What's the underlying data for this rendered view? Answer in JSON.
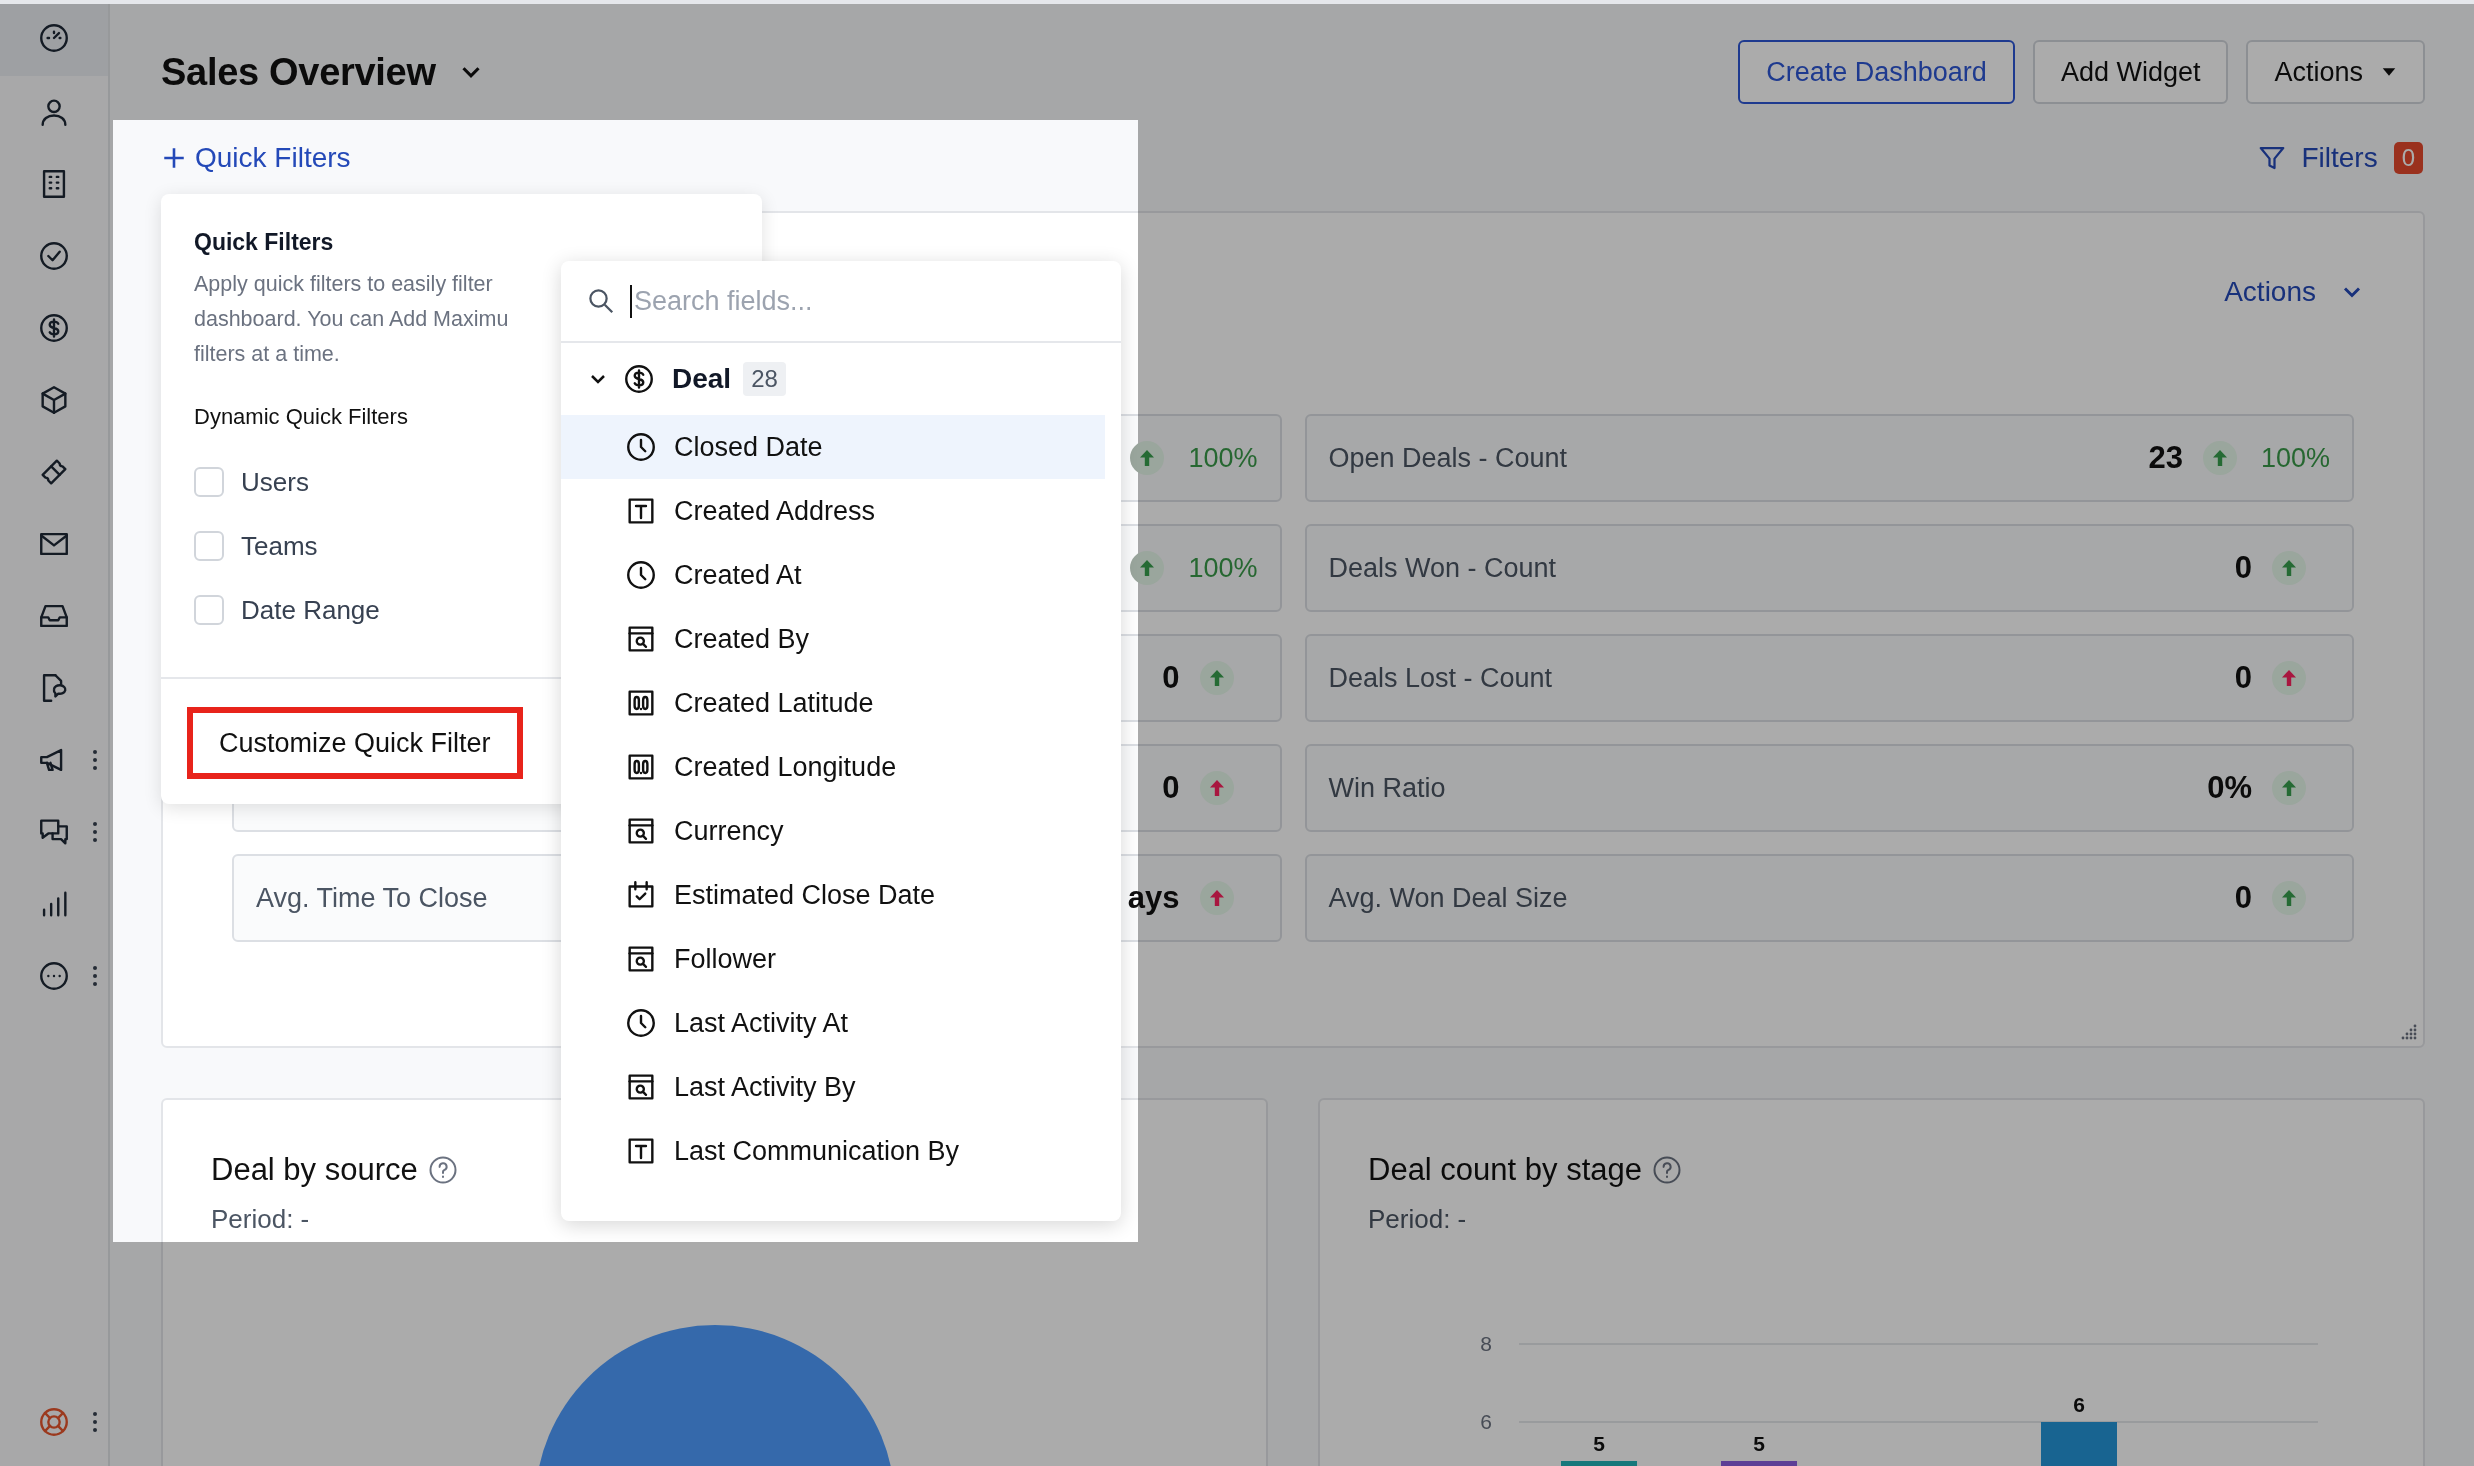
{
  "sidebar": {
    "items": [
      {
        "selected": true,
        "menu": false
      },
      {
        "selected": false,
        "menu": false
      },
      {
        "selected": false,
        "menu": false
      },
      {
        "selected": false,
        "menu": false
      },
      {
        "selected": false,
        "menu": false
      },
      {
        "selected": false,
        "menu": false
      },
      {
        "selected": false,
        "menu": false
      },
      {
        "selected": false,
        "menu": false
      },
      {
        "selected": false,
        "menu": false
      },
      {
        "selected": false,
        "menu": false
      },
      {
        "selected": false,
        "menu": true
      },
      {
        "selected": false,
        "menu": true
      },
      {
        "selected": false,
        "menu": false
      },
      {
        "selected": false,
        "menu": true
      }
    ],
    "help": {
      "menu": true
    }
  },
  "header": {
    "title": "Sales Overview",
    "buttons": [
      {
        "label": "Create Dashboard",
        "kind": "primary"
      },
      {
        "label": "Add Widget",
        "kind": "default"
      },
      {
        "label": "Actions",
        "kind": "dropdown"
      }
    ]
  },
  "quick_filters_link": "Quick Filters",
  "filters": {
    "label": "Filters",
    "count": "0"
  },
  "quick_filters_popover": {
    "title": "Quick Filters",
    "description": [
      "Apply quick filters to easily filter",
      "dashboard. You can Add Maximu",
      "filters at a time."
    ],
    "section": "Dynamic Quick Filters",
    "options": [
      {
        "label": "Users",
        "checked": false
      },
      {
        "label": "Teams",
        "checked": false
      },
      {
        "label": "Date Range",
        "checked": false
      }
    ],
    "button": "Customize Quick Filter"
  },
  "field_picker": {
    "placeholder": "Search fields...",
    "group": {
      "label": "Deal",
      "count": "28",
      "expanded": true
    },
    "fields": [
      {
        "label": "Closed Date",
        "kind": "datetime",
        "selected": true
      },
      {
        "label": "Created Address",
        "kind": "text",
        "selected": false
      },
      {
        "label": "Created At",
        "kind": "datetime",
        "selected": false
      },
      {
        "label": "Created By",
        "kind": "lookup",
        "selected": false
      },
      {
        "label": "Created Latitude",
        "kind": "number",
        "selected": false
      },
      {
        "label": "Created Longitude",
        "kind": "number",
        "selected": false
      },
      {
        "label": "Currency",
        "kind": "lookup",
        "selected": false
      },
      {
        "label": "Estimated Close Date",
        "kind": "date",
        "selected": false
      },
      {
        "label": "Follower",
        "kind": "lookup",
        "selected": false
      },
      {
        "label": "Last Activity At",
        "kind": "datetime",
        "selected": false
      },
      {
        "label": "Last Activity By",
        "kind": "lookup",
        "selected": false
      },
      {
        "label": "Last Communication By",
        "kind": "text",
        "selected": false
      }
    ]
  },
  "kpi_widget": {
    "actions": "Actions",
    "left": [
      {
        "change": "100%",
        "color": "#256b34"
      },
      {
        "change": "100%",
        "color": "#256b34"
      },
      {
        "value": "0",
        "color": "#256b34"
      },
      {
        "value": "0",
        "color": "#a8173f"
      },
      {
        "label": "Avg. Time To Close",
        "value": "ays",
        "color": "#a8173f"
      }
    ],
    "right": [
      {
        "label": "Open Deals - Count",
        "value": "23",
        "change": "100%",
        "color": "#256b34"
      },
      {
        "label": "Deals Won - Count",
        "value": "0",
        "color": "#256b34"
      },
      {
        "label": "Deals Lost - Count",
        "value": "0",
        "color": "#a8173f"
      },
      {
        "label": "Win Ratio",
        "value": "0%",
        "color": "#256b34"
      },
      {
        "label": "Avg. Won Deal Size",
        "value": "0",
        "color": "#256b34"
      }
    ]
  },
  "charts": [
    {
      "title": "Deal by source",
      "period": "Period: -",
      "kind": "pie"
    },
    {
      "title": "Deal count by stage",
      "period": "Period: -",
      "kind": "bar",
      "chart_data": {
        "type": "bar",
        "values": [
          5,
          5,
          null,
          6,
          null
        ],
        "ylim": [
          4.8,
          8
        ],
        "yticks": [
          6,
          8
        ],
        "data_labels": true
      }
    }
  ]
}
